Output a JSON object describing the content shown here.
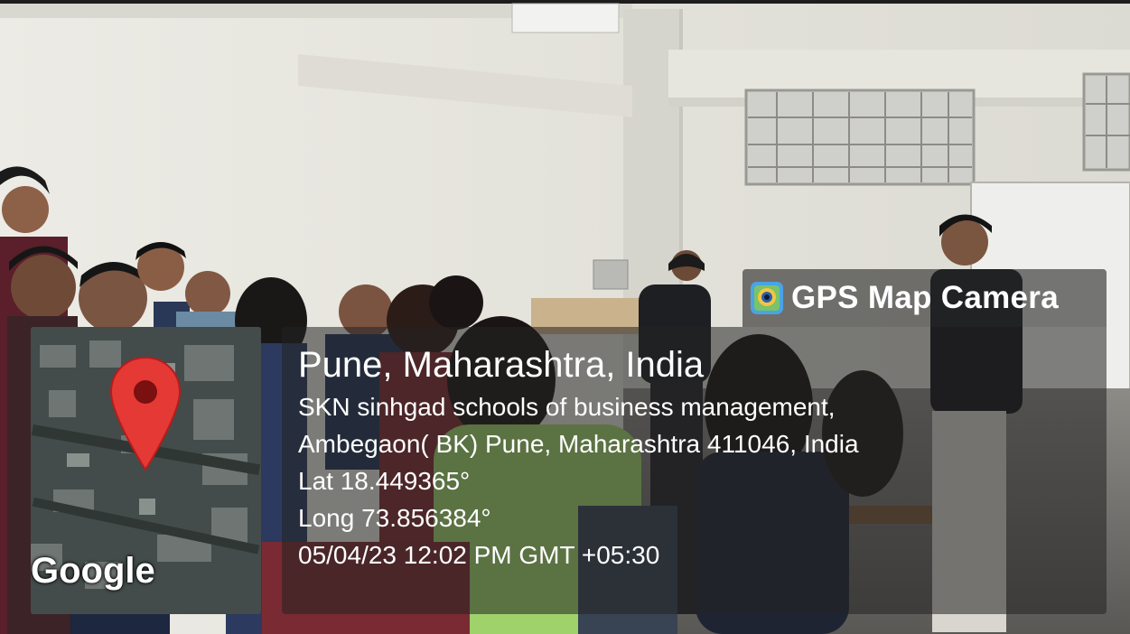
{
  "overlay": {
    "app_name": "GPS Map Camera",
    "app_icon": "gps-map-camera-icon",
    "city": "Pune, Maharashtra, India",
    "address_line_1": "SKN sinhgad schools of business management,",
    "address_line_2": "Ambegaon( BK) Pune, Maharashtra 411046, India",
    "latitude": "Lat 18.449365°",
    "longitude": "Long 73.856384°",
    "timestamp": "05/04/23 12:02 PM GMT +05:30"
  },
  "map_thumbnail": {
    "watermark": "Google",
    "marker_icon": "map-pin-icon",
    "marker_color": "#e53935"
  },
  "colors": {
    "overlay_bg": "#232323",
    "overlay_text": "#ffffff",
    "wall": "#e8e6df"
  }
}
